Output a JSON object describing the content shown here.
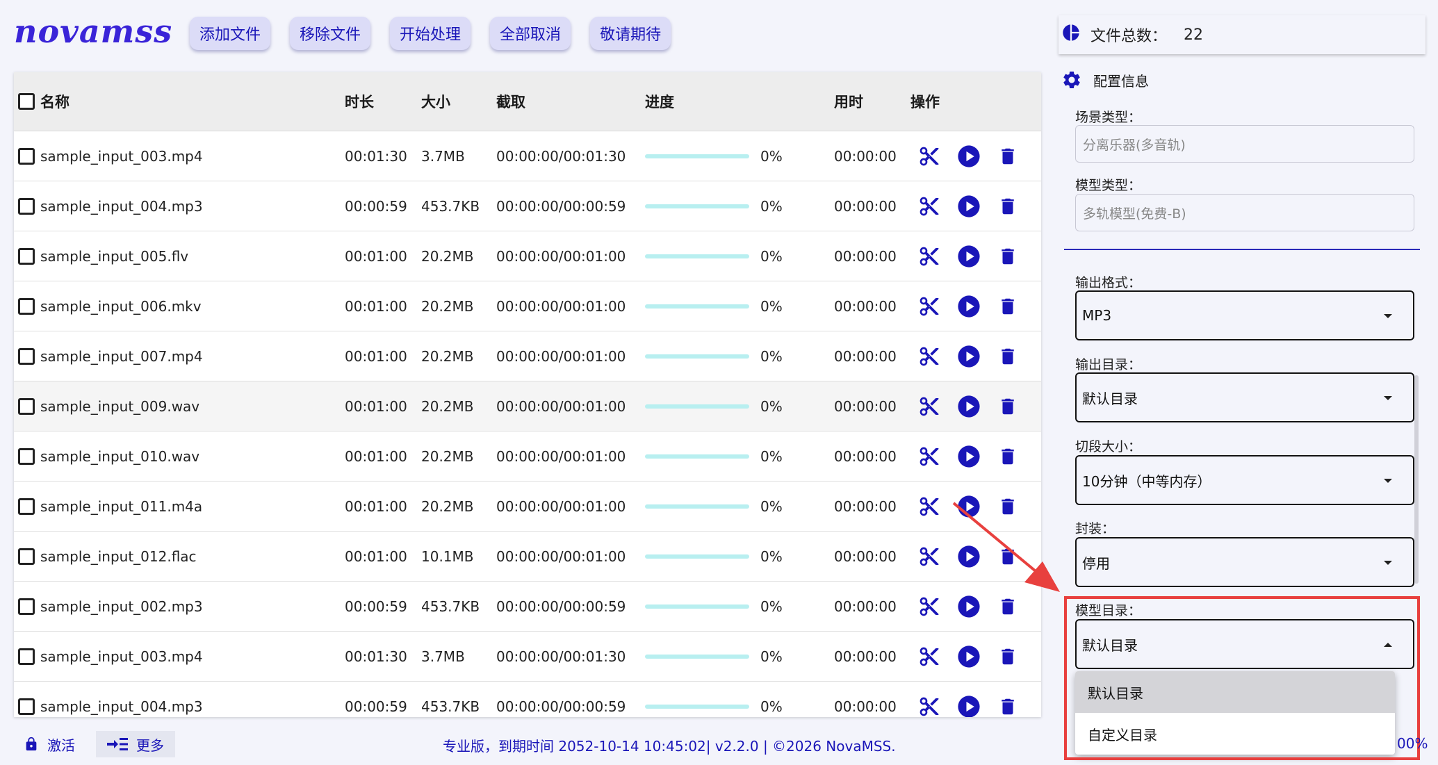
{
  "app": {
    "logo": "novamss"
  },
  "toolbar": {
    "buttons": [
      "添加文件",
      "移除文件",
      "开始处理",
      "全部取消",
      "敬请期待"
    ]
  },
  "table": {
    "headers": {
      "name": "名称",
      "duration": "时长",
      "size": "大小",
      "cut": "截取",
      "progress": "进度",
      "elapsed": "用时",
      "ops": "操作"
    },
    "rows": [
      {
        "name": "sample_input_003.mp4",
        "duration": "00:01:30",
        "size": "3.7MB",
        "cut": "00:00:00/00:01:30",
        "progress": "0%",
        "elapsed": "00:00:00"
      },
      {
        "name": "sample_input_004.mp3",
        "duration": "00:00:59",
        "size": "453.7KB",
        "cut": "00:00:00/00:00:59",
        "progress": "0%",
        "elapsed": "00:00:00"
      },
      {
        "name": "sample_input_005.flv",
        "duration": "00:01:00",
        "size": "20.2MB",
        "cut": "00:00:00/00:01:00",
        "progress": "0%",
        "elapsed": "00:00:00"
      },
      {
        "name": "sample_input_006.mkv",
        "duration": "00:01:00",
        "size": "20.2MB",
        "cut": "00:00:00/00:01:00",
        "progress": "0%",
        "elapsed": "00:00:00"
      },
      {
        "name": "sample_input_007.mp4",
        "duration": "00:01:00",
        "size": "20.2MB",
        "cut": "00:00:00/00:01:00",
        "progress": "0%",
        "elapsed": "00:00:00"
      },
      {
        "name": "sample_input_009.wav",
        "duration": "00:01:00",
        "size": "20.2MB",
        "cut": "00:00:00/00:01:00",
        "progress": "0%",
        "elapsed": "00:00:00"
      },
      {
        "name": "sample_input_010.wav",
        "duration": "00:01:00",
        "size": "20.2MB",
        "cut": "00:00:00/00:01:00",
        "progress": "0%",
        "elapsed": "00:00:00"
      },
      {
        "name": "sample_input_011.m4a",
        "duration": "00:01:00",
        "size": "20.2MB",
        "cut": "00:00:00/00:01:00",
        "progress": "0%",
        "elapsed": "00:00:00"
      },
      {
        "name": "sample_input_012.flac",
        "duration": "00:01:00",
        "size": "10.1MB",
        "cut": "00:00:00/00:01:00",
        "progress": "0%",
        "elapsed": "00:00:00"
      },
      {
        "name": "sample_input_002.mp3",
        "duration": "00:00:59",
        "size": "453.7KB",
        "cut": "00:00:00/00:00:59",
        "progress": "0%",
        "elapsed": "00:00:00"
      },
      {
        "name": "sample_input_003.mp4",
        "duration": "00:01:30",
        "size": "3.7MB",
        "cut": "00:00:00/00:01:30",
        "progress": "0%",
        "elapsed": "00:00:00"
      },
      {
        "name": "sample_input_004.mp3",
        "duration": "00:00:59",
        "size": "453.7KB",
        "cut": "00:00:00/00:00:59",
        "progress": "0%",
        "elapsed": "00:00:00"
      }
    ]
  },
  "summary": {
    "label": "文件总数：",
    "value": "22"
  },
  "config": {
    "title": "配置信息",
    "scene_label": "场景类型：",
    "scene_value": "分离乐器(多音轨)",
    "model_label": "模型类型：",
    "model_value": "多轨模型(免费-B)",
    "format_label": "输出格式：",
    "format_value": "MP3",
    "outdir_label": "输出目录：",
    "outdir_value": "默认目录",
    "segment_label": "切段大小：",
    "segment_value": "10分钟（中等内存）",
    "wrap_label": "封装：",
    "wrap_value": "停用",
    "modeldir_label": "模型目录：",
    "modeldir_value": "默认目录",
    "modeldir_options": [
      "默认目录",
      "自定义目录"
    ]
  },
  "footer": {
    "activate": "激活",
    "more": "更多",
    "status": "专业版，到期时间 2052-10-14 10:45:02| v2.2.0 | ©2026 NovaMSS.",
    "percent": "00%"
  },
  "colors": {
    "accent": "#1a16b8",
    "logo": "#3a24d8",
    "highlight": "#e8403e",
    "progress_track": "#b8eff0"
  }
}
